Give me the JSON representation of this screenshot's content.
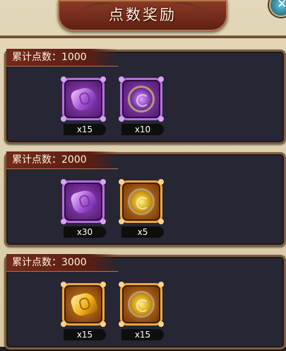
{
  "header": {
    "title": "点数奖励"
  },
  "close_button": {
    "icon": "close-icon",
    "glyph": "✕"
  },
  "rewards": [
    {
      "label": "累计点数：1000",
      "items": [
        {
          "icon": "purple-crystal-icon",
          "qty": "x15"
        },
        {
          "icon": "purple-orb-icon",
          "qty": "x10"
        }
      ]
    },
    {
      "label": "累计点数：2000",
      "items": [
        {
          "icon": "purple-crystal-icon",
          "qty": "x30"
        },
        {
          "icon": "gold-orb-icon",
          "qty": "x5"
        }
      ]
    },
    {
      "label": "累计点数：3000",
      "items": [
        {
          "icon": "gold-crystal-icon",
          "qty": "x15"
        },
        {
          "icon": "gold-orb-icon",
          "qty": "x15"
        }
      ]
    }
  ],
  "colors": {
    "panel_bg": "#262634",
    "header_red": "#73291b",
    "purple_frame": "#b86de3",
    "orange_frame": "#efa73f"
  }
}
